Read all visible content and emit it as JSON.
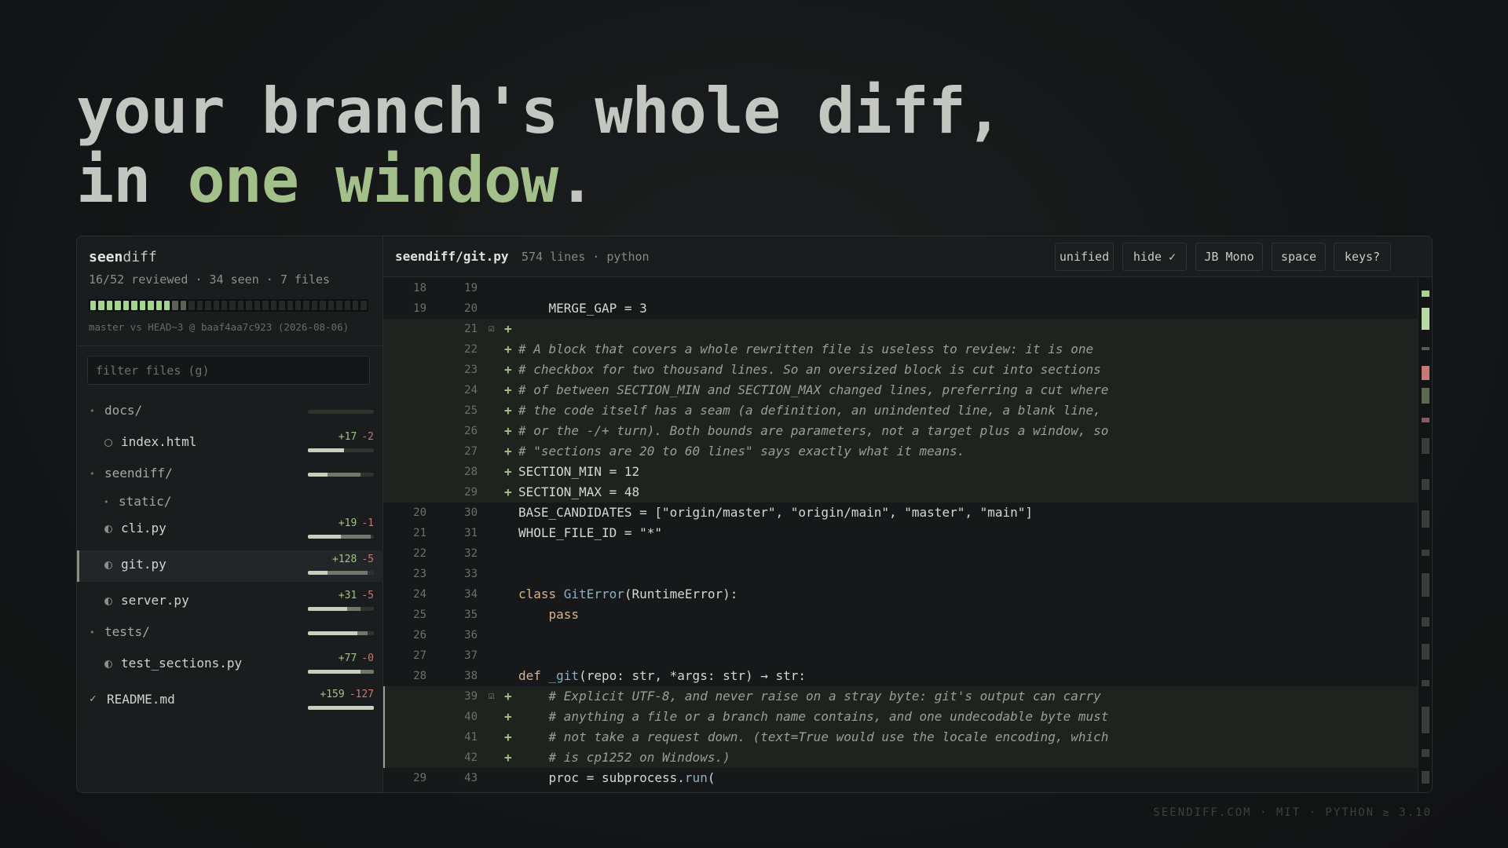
{
  "headline": {
    "line1": "your branch's whole diff,",
    "line2_pre": "in ",
    "line2_accent": "one window",
    "line2_post": "."
  },
  "sidebar": {
    "brand_bold": "seen",
    "brand_light": "diff",
    "stats": "16/52 reviewed · 34 seen · 7 files",
    "progress": {
      "reviewed": 16,
      "seen": 34,
      "total": 52
    },
    "base": "master vs HEAD~3 @ baaf4aa7c923 (2026-08-06)",
    "filter_placeholder": "filter files (g)",
    "tree": [
      {
        "kind": "dir",
        "name": "docs/",
        "reviewed_fraction": 0,
        "seen_fraction": 0
      },
      {
        "kind": "file",
        "name": "index.html",
        "add": "+17",
        "del": "-2",
        "status": "unseen",
        "reviewed_fraction": 0.55,
        "seen_fraction": 0
      },
      {
        "kind": "dir",
        "name": "seendiff/",
        "reviewed_fraction": 0.3,
        "seen_fraction": 0.5
      },
      {
        "kind": "subdir",
        "name": "static/"
      },
      {
        "kind": "file",
        "name": "cli.py",
        "add": "+19",
        "del": "-1",
        "status": "partial",
        "reviewed_fraction": 0.5,
        "seen_fraction": 0.45
      },
      {
        "kind": "file",
        "name": "git.py",
        "add": "+128",
        "del": "-5",
        "status": "partial",
        "reviewed_fraction": 0.3,
        "seen_fraction": 0.6,
        "selected": true
      },
      {
        "kind": "file",
        "name": "server.py",
        "add": "+31",
        "del": "-5",
        "status": "partial",
        "reviewed_fraction": 0.6,
        "seen_fraction": 0.2
      },
      {
        "kind": "dir",
        "name": "tests/",
        "reviewed_fraction": 0.75,
        "seen_fraction": 0.15
      },
      {
        "kind": "file",
        "name": "test_sections.py",
        "add": "+77",
        "del": "-0",
        "status": "partial",
        "reviewed_fraction": 0.8,
        "seen_fraction": 0.2
      },
      {
        "kind": "done",
        "name": "README.md",
        "add": "+159",
        "del": "-127",
        "reviewed_fraction": 1,
        "seen_fraction": 0
      }
    ]
  },
  "main": {
    "file_path": "seendiff/git.py",
    "file_meta": "574 lines · python",
    "buttons": [
      "unified",
      "hide ✓",
      "JB Mono",
      "space",
      "keys?"
    ],
    "lines": [
      {
        "old": "18",
        "new": "19",
        "type": "ctx",
        "text": ""
      },
      {
        "old": "19",
        "new": "20",
        "type": "ctx",
        "text": "    MERGE_GAP = 3"
      },
      {
        "old": "",
        "new": "21",
        "type": "add",
        "checkbox": "☑",
        "text": ""
      },
      {
        "old": "",
        "new": "22",
        "type": "add",
        "comment": true,
        "text": "# A block that covers a whole rewritten file is useless to review: it is one"
      },
      {
        "old": "",
        "new": "23",
        "type": "add",
        "comment": true,
        "text": "# checkbox for two thousand lines. So an oversized block is cut into sections"
      },
      {
        "old": "",
        "new": "24",
        "type": "add",
        "comment": true,
        "text": "# of between SECTION_MIN and SECTION_MAX changed lines, preferring a cut where"
      },
      {
        "old": "",
        "new": "25",
        "type": "add",
        "comment": true,
        "text": "# the code itself has a seam (a definition, an unindented line, a blank line,"
      },
      {
        "old": "",
        "new": "26",
        "type": "add",
        "comment": true,
        "text": "# or the -/+ turn). Both bounds are parameters, not a target plus a window, so"
      },
      {
        "old": "",
        "new": "27",
        "type": "add",
        "comment": true,
        "text": "# \"sections are 20 to 60 lines\" says exactly what it means."
      },
      {
        "old": "",
        "new": "28",
        "type": "add",
        "text": "SECTION_MIN = 12"
      },
      {
        "old": "",
        "new": "29",
        "type": "add",
        "text": "SECTION_MAX = 48"
      },
      {
        "old": "20",
        "new": "30",
        "type": "ctx",
        "text": "BASE_CANDIDATES = [\"origin/master\", \"origin/main\", \"master\", \"main\"]"
      },
      {
        "old": "21",
        "new": "31",
        "type": "ctx",
        "text": "WHOLE_FILE_ID = \"*\""
      },
      {
        "old": "22",
        "new": "32",
        "type": "ctx",
        "text": ""
      },
      {
        "old": "23",
        "new": "33",
        "type": "ctx",
        "text": ""
      },
      {
        "old": "24",
        "new": "34",
        "type": "ctx",
        "kw": "class ",
        "fn": "GitError",
        "text": "(RuntimeError):"
      },
      {
        "old": "25",
        "new": "35",
        "type": "ctx",
        "kw": "    pass",
        "text": ""
      },
      {
        "old": "26",
        "new": "36",
        "type": "ctx",
        "text": ""
      },
      {
        "old": "27",
        "new": "37",
        "type": "ctx",
        "text": ""
      },
      {
        "old": "28",
        "new": "38",
        "type": "ctx",
        "kw": "def ",
        "fn": "_git",
        "text": "(repo: str, *args: str) → str:"
      },
      {
        "old": "",
        "new": "39",
        "type": "add",
        "checkbox": "☑",
        "comment": true,
        "text": "    # Explicit UTF-8, and never raise on a stray byte: git's output can carry"
      },
      {
        "old": "",
        "new": "40",
        "type": "add",
        "comment": true,
        "text": "    # anything a file or a branch name contains, and one undecodable byte must"
      },
      {
        "old": "",
        "new": "41",
        "type": "add",
        "comment": true,
        "text": "    # not take a request down. (text=True would use the locale encoding, which"
      },
      {
        "old": "",
        "new": "42",
        "type": "add",
        "comment": true,
        "text": "    # is cp1252 on Windows.)"
      },
      {
        "old": "29",
        "new": "43",
        "type": "ctx",
        "pre": "    proc = subprocess.",
        "fn": "run",
        "text": "("
      }
    ]
  },
  "footer": "SEENDIFF.COM · MIT · PYTHON ≥ 3.10",
  "colors": {
    "accent": "#a3c08a",
    "deletion": "#c87878",
    "background": "#141617"
  }
}
